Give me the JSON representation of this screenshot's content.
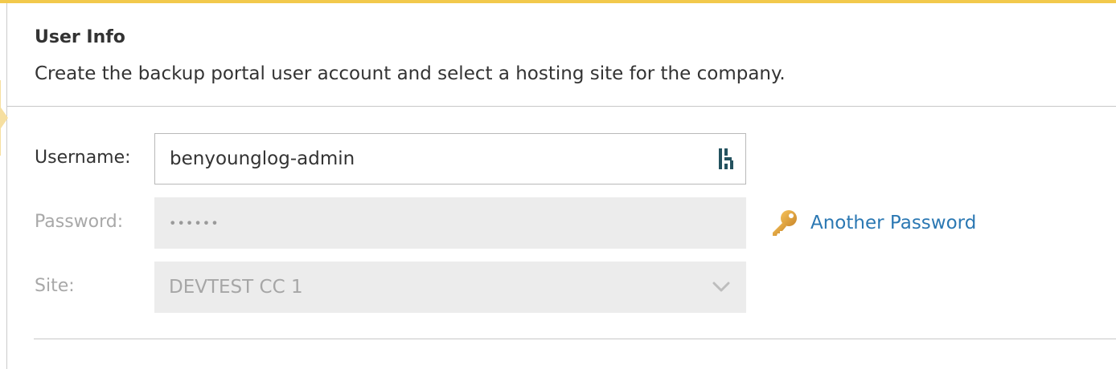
{
  "section": {
    "title": "User Info",
    "description": "Create the backup portal user account and select a hosting site for the company."
  },
  "form": {
    "username": {
      "label": "Username:",
      "value": "benyounglog-admin",
      "icon": "password-manager-icon"
    },
    "password": {
      "label": "Password:",
      "value": "••••••",
      "disabled": true
    },
    "site": {
      "label": "Site:",
      "value": "DEVTEST CC 1",
      "disabled": true,
      "icon": "chevron-down-icon"
    },
    "another_password": {
      "label": "Another Password",
      "icon": "key-icon"
    }
  },
  "colors": {
    "accent": "#f2c94c",
    "link": "#2b78b3",
    "disabled_bg": "#ececec",
    "disabled_text": "#a6a6a6",
    "key_gold": "#e0a63a"
  }
}
